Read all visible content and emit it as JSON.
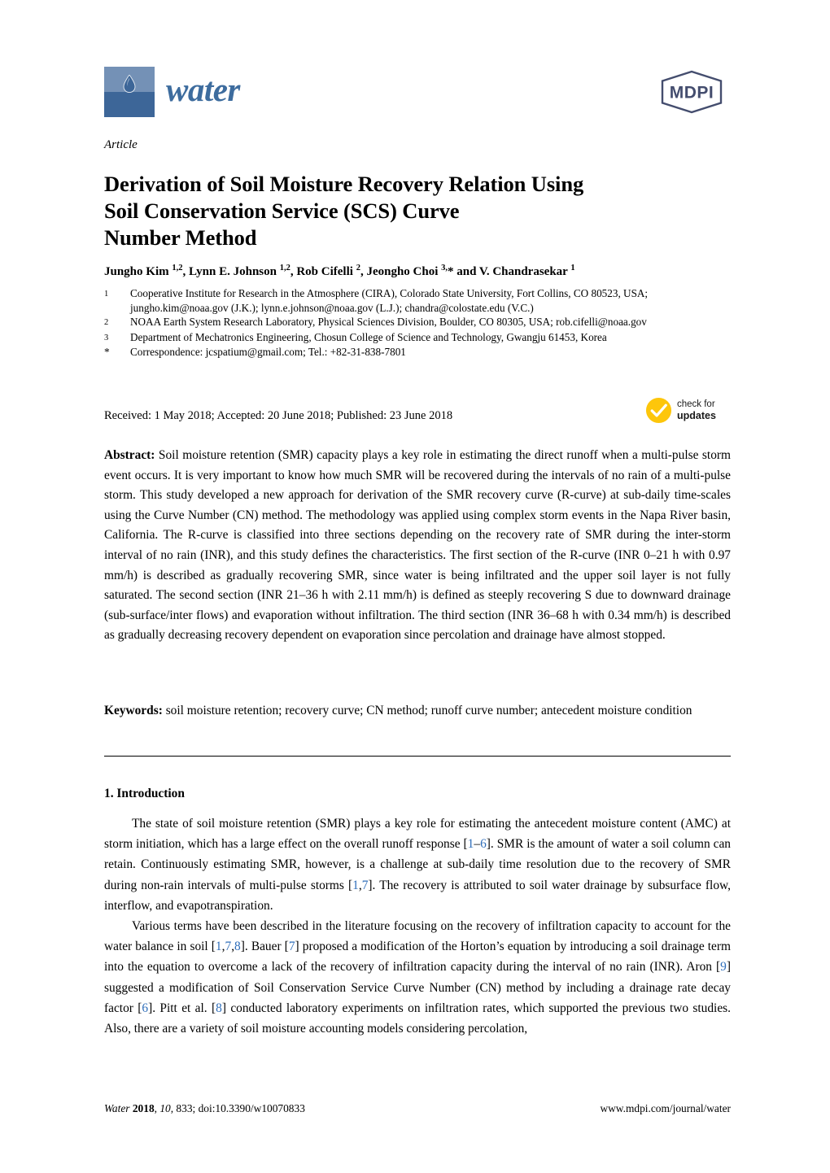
{
  "journal": {
    "name": "water",
    "logo_top_color": "#7491b6",
    "logo_bottom_color": "#3d6698",
    "wordmark_color": "#3d6c9e",
    "publisher_logo_text": "MDPI",
    "publisher_logo_color": "#444d6e"
  },
  "article": {
    "type": "Article",
    "title": "Derivation of Soil Moisture Recovery Relation Using Soil Conservation Service (SCS) Curve Number Method",
    "title_lines": [
      "Derivation of Soil Moisture Recovery Relation Using",
      "Soil Conservation Service (SCS) Curve",
      "Number Method"
    ]
  },
  "authors": {
    "line_html": "Jungho Kim <sup>1,2</sup>, Lynn E. Johnson <sup>1,2</sup>, Rob Cifelli <sup>2</sup>, Jeongho Choi <sup>3,</sup>* and V. Chandrasekar <sup>1</sup>",
    "names": [
      {
        "name": "Jungho Kim",
        "affiliations": "1,2"
      },
      {
        "name": "Lynn E. Johnson",
        "affiliations": "1,2"
      },
      {
        "name": "Rob Cifelli",
        "affiliations": "2"
      },
      {
        "name": "Jeongho Choi",
        "affiliations": "3,*"
      },
      {
        "name": "V. Chandrasekar",
        "affiliations": "1"
      }
    ]
  },
  "affiliations": [
    {
      "marker": "1",
      "text": "Cooperative Institute for Research in the Atmosphere (CIRA), Colorado State University, Fort Collins, CO 80523, USA; jungho.kim@noaa.gov (J.K.); lynn.e.johnson@noaa.gov (L.J.); chandra@colostate.edu (V.C.)"
    },
    {
      "marker": "2",
      "text": "NOAA Earth System Research Laboratory, Physical Sciences Division, Boulder, CO 80305, USA; rob.cifelli@noaa.gov"
    },
    {
      "marker": "3",
      "text": "Department of Mechatronics Engineering, Chosun College of Science and Technology, Gwangju 61453, Korea"
    },
    {
      "marker": "*",
      "text": "Correspondence: jcspatium@gmail.com; Tel.: +82-31-838-7801"
    }
  ],
  "dates": {
    "line": "Received: 1 May 2018; Accepted: 20 June 2018; Published: 23 June 2018",
    "received": "1 May 2018",
    "accepted": "20 June 2018",
    "published": "23 June 2018"
  },
  "crossmark": {
    "line1": "check for",
    "line2": "updates",
    "color": "#fdc60b"
  },
  "abstract": {
    "label": "Abstract:",
    "text": "Soil moisture retention (SMR) capacity plays a key role in estimating the direct runoff when a multi-pulse storm event occurs. It is very important to know how much SMR will be recovered during the intervals of no rain of a multi-pulse storm.  This study developed a new approach for derivation of the SMR recovery curve (R-curve) at sub-daily time-scales using the Curve Number (CN) method. The methodology was applied using complex storm events in the Napa River basin, California. The R-curve is classified into three sections depending on the recovery rate of SMR during the inter-storm interval of no rain (INR), and this study defines the characteristics. The first section of the R-curve (INR 0–21 h with 0.97 mm/h) is described as gradually recovering SMR, since water is being infiltrated and the upper soil layer is not fully saturated. The second section (INR 21–36 h with 2.11 mm/h) is defined as steeply recovering S due to downward drainage (sub-surface/inter flows) and evaporation without infiltration. The third section (INR 36–68 h with 0.34 mm/h) is described as gradually decreasing recovery dependent on evaporation since percolation and drainage have almost stopped."
  },
  "keywords": {
    "label": "Keywords:",
    "text": "soil moisture retention; recovery curve; CN method; runoff curve number; antecedent moisture condition",
    "list": [
      "soil moisture retention",
      "recovery curve",
      "CN method",
      "runoff curve number",
      "antecedent moisture condition"
    ]
  },
  "introduction": {
    "heading": "1. Introduction",
    "paragraph1_html": "The state of soil moisture retention (SMR) plays a key role for estimating the antecedent moisture content (AMC) at storm initiation, which has a large effect on the overall runoff response [<span class=\"cite\">1</span>–<span class=\"cite\">6</span>]. SMR is the amount of water a soil column can retain. Continuously estimating SMR, however, is a challenge at sub-daily time resolution due to the recovery of SMR during non-rain intervals of multi-pulse storms [<span class=\"cite\">1</span>,<span class=\"cite\">7</span>]. The recovery is attributed to soil water drainage by subsurface flow, interflow, and evapotranspiration.",
    "paragraph2_html": "Various terms have been described in the literature focusing on the recovery of infiltration capacity to account for the water balance in soil [<span class=\"cite\">1</span>,<span class=\"cite\">7</span>,<span class=\"cite\">8</span>].  Bauer [<span class=\"cite\">7</span>] proposed a modification of the Horton’s equation by introducing a soil drainage term into the equation to overcome a lack of the recovery of infiltration capacity during the interval of no rain (INR). Aron [<span class=\"cite\">9</span>] suggested a modification of Soil Conservation Service Curve Number (CN) method by including a drainage rate decay factor [<span class=\"cite\">6</span>]. Pitt et al. [<span class=\"cite\">8</span>] conducted laboratory experiments on infiltration rates, which supported the previous two studies.  Also, there are a variety of soil moisture accounting models considering percolation,",
    "citation_color": "#2f6eba"
  },
  "footer": {
    "left_html": "<i>Water</i> <b>2018</b>, <i>10</i>, 833; doi:10.3390/w10070833",
    "left_text": "Water 2018, 10, 833; doi:10.3390/w10070833",
    "right_text": "www.mdpi.com/journal/water"
  }
}
